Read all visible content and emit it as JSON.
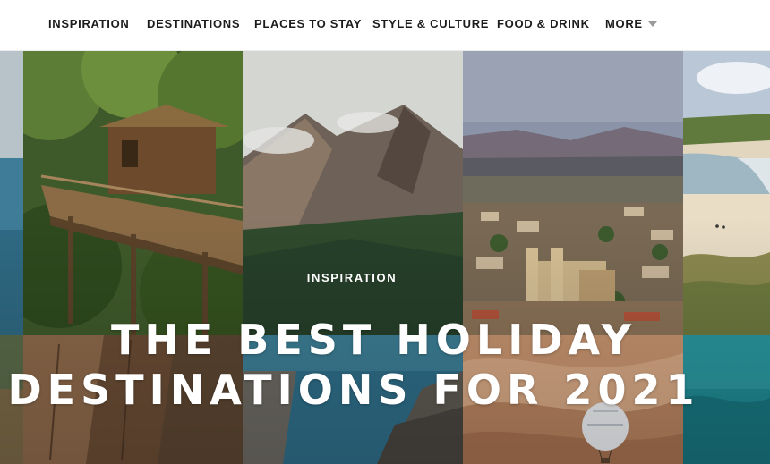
{
  "nav": {
    "items": [
      {
        "label": "INSPIRATION"
      },
      {
        "label": "DESTINATIONS"
      },
      {
        "label": "PLACES TO STAY"
      },
      {
        "label": "STYLE & CULTURE"
      },
      {
        "label": "FOOD & DRINK"
      },
      {
        "label": "MORE"
      }
    ],
    "more_icon": "chevron-down-icon"
  },
  "hero": {
    "kicker": "INSPIRATION",
    "headline_line1": "THE BEST HOLIDAY",
    "headline_line2": "DESTINATIONS FOR 2021",
    "tiles": [
      {
        "name": "coast-cliff-strip"
      },
      {
        "name": "treehouse-jungle"
      },
      {
        "name": "volcano-peaks"
      },
      {
        "name": "mexican-town"
      },
      {
        "name": "beach-dunes"
      },
      {
        "name": "canyon-cliffs"
      },
      {
        "name": "rocky-sea-coast"
      },
      {
        "name": "desert-balloon"
      },
      {
        "name": "turquoise-sea"
      }
    ]
  },
  "colors": {
    "nav_text": "#1c1c1c",
    "headline": "#ffffff",
    "accent_underline": "#ffffff"
  }
}
